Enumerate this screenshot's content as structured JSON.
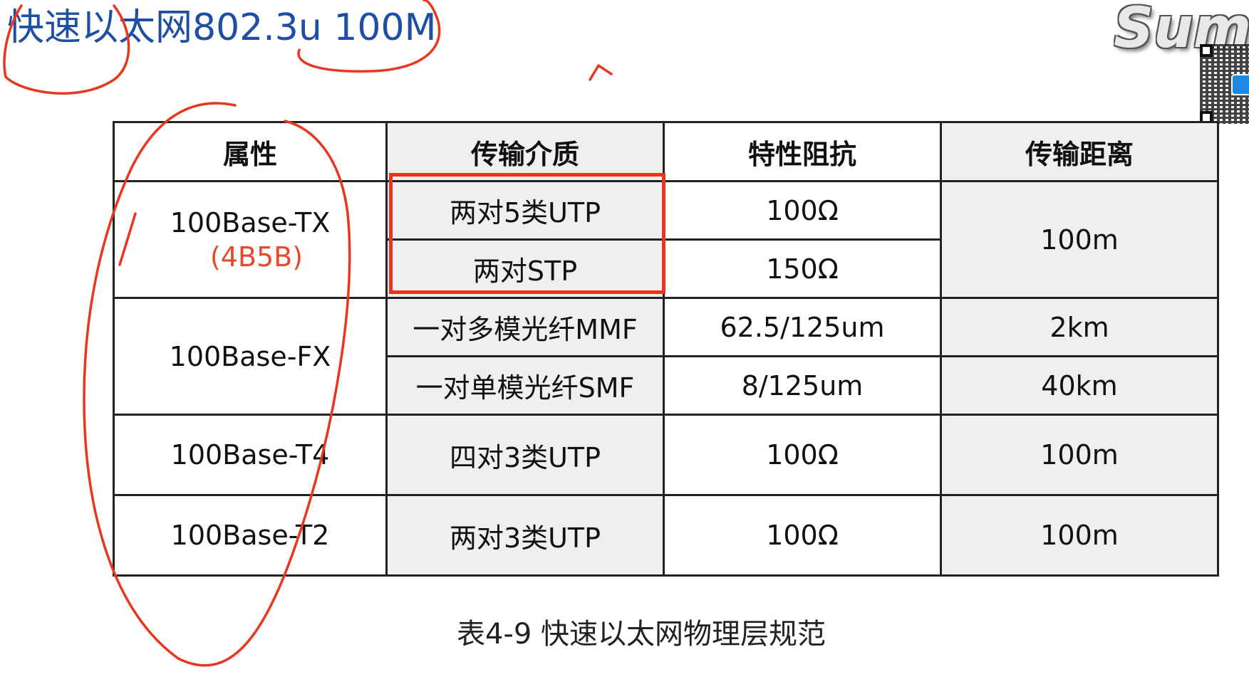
{
  "slide": {
    "title": "快速以太网802.3u 100M",
    "caption": "表4-9 快速以太网物理层规范"
  },
  "logo": {
    "text": "Sumn"
  },
  "table": {
    "headers": [
      "属性",
      "传输介质",
      "特性阻抗",
      "传输距离"
    ],
    "groups": [
      {
        "attribute": "100Base-TX",
        "note": "(4B5B)",
        "distance": "100m",
        "rows": [
          {
            "medium": "两对5类UTP",
            "impedance": "100Ω"
          },
          {
            "medium": "两对STP",
            "impedance": "150Ω"
          }
        ]
      },
      {
        "attribute": "100Base-FX",
        "rows": [
          {
            "medium": "一对多模光纤MMF",
            "impedance": "62.5/125um",
            "distance": "2km"
          },
          {
            "medium": "一对单模光纤SMF",
            "impedance": "8/125um",
            "distance": "40km"
          }
        ]
      },
      {
        "attribute": "100Base-T4",
        "rows": [
          {
            "medium": "四对3类UTP",
            "impedance": "100Ω",
            "distance": "100m"
          }
        ]
      },
      {
        "attribute": "100Base-T2",
        "rows": [
          {
            "medium": "两对3类UTP",
            "impedance": "100Ω",
            "distance": "100m"
          }
        ]
      }
    ]
  },
  "annotations": {
    "ink_color": "#e8361f",
    "highlight_box_color": "#e8361f"
  }
}
